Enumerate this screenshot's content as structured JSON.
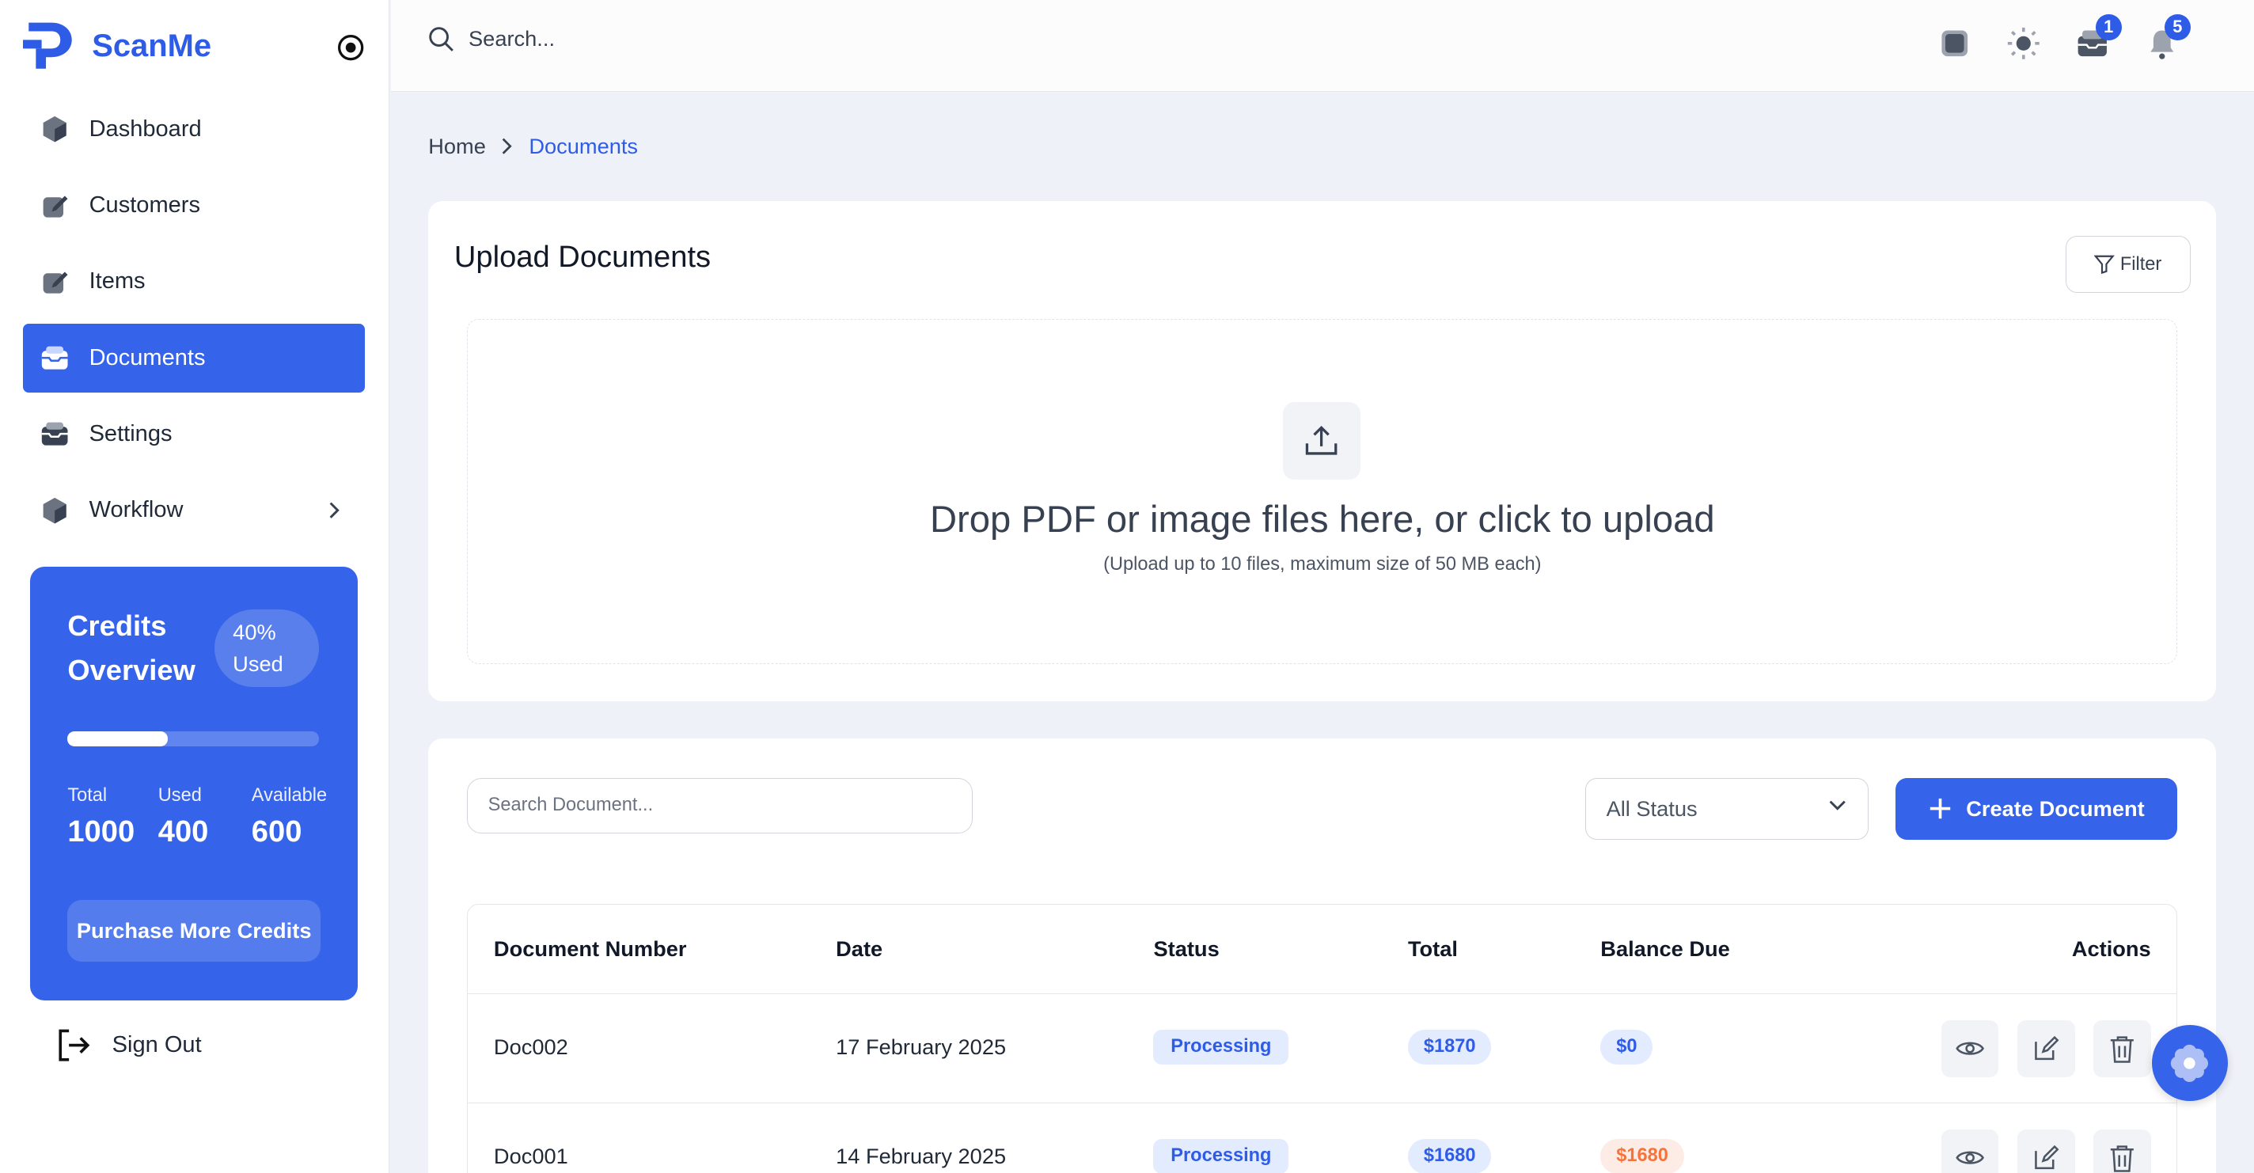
{
  "app": {
    "name": "ScanMe"
  },
  "sidebar": {
    "items": [
      {
        "label": "Dashboard",
        "icon": "cube-icon"
      },
      {
        "label": "Customers",
        "icon": "edit-icon"
      },
      {
        "label": "Items",
        "icon": "edit-icon"
      },
      {
        "label": "Documents",
        "icon": "inbox-icon",
        "active": true
      },
      {
        "label": "Settings",
        "icon": "inbox-icon"
      },
      {
        "label": "Workflow",
        "icon": "cube-icon"
      }
    ],
    "sign_out": "Sign Out"
  },
  "credits": {
    "title": "Credits Overview",
    "used_pill_percent": "40%",
    "used_pill_label": "Used",
    "used_fraction": 0.4,
    "total_label": "Total",
    "total_value": "1000",
    "used_label": "Used",
    "used_value": "400",
    "available_label": "Available",
    "available_value": "600",
    "purchase_button": "Purchase More Credits"
  },
  "topbar": {
    "search_placeholder": "Search...",
    "icons": [
      "fullscreen-icon",
      "sun-icon",
      "inbox-icon",
      "bell-icon"
    ],
    "inbox_badge": "1",
    "notifications_badge": "5"
  },
  "breadcrumb": {
    "home": "Home",
    "current": "Documents"
  },
  "upload": {
    "title": "Upload Documents",
    "filter_label": "Filter",
    "drop_text": "Drop PDF or image files here, or click to upload",
    "drop_hint": "(Upload up to 10 files, maximum size of 50 MB each)"
  },
  "documents": {
    "search_placeholder": "Search Document...",
    "status_filter": "All Status",
    "create_button": "Create Document",
    "columns": [
      "Document Number",
      "Date",
      "Status",
      "Total",
      "Balance Due",
      "Actions"
    ],
    "rows": [
      {
        "number": "Doc002",
        "date": "17 February 2025",
        "status": "Processing",
        "total": "$1870",
        "balance": "$0"
      },
      {
        "number": "Doc001",
        "date": "14 February 2025",
        "status": "Processing",
        "total": "$1680",
        "balance": "$1680"
      }
    ]
  },
  "colors": {
    "accent": "#3563e9",
    "brand": "#2e5ce6",
    "due": "#f4743b",
    "background": "#eef1f7"
  }
}
